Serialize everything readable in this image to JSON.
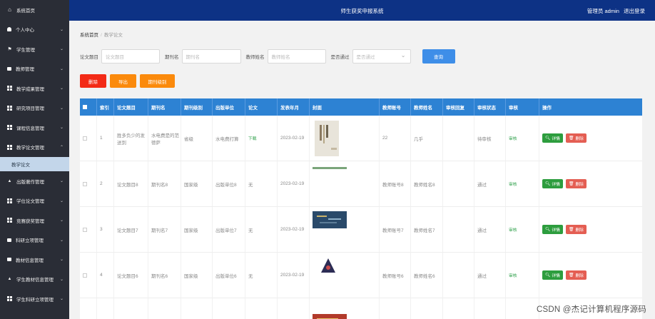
{
  "app": {
    "title": "师生获奖申报系统",
    "user_label": "管理员 admin",
    "logout": "退出登录"
  },
  "sidebar": {
    "items": [
      {
        "label": "系统首页"
      },
      {
        "label": "个人中心"
      },
      {
        "label": "学生管理"
      },
      {
        "label": "教师管理"
      },
      {
        "label": "教学成果管理"
      },
      {
        "label": "研究项目管理"
      },
      {
        "label": "课程信息管理"
      },
      {
        "label": "教学论文管理"
      },
      {
        "label": "出版著作管理"
      },
      {
        "label": "学位论文管理"
      },
      {
        "label": "竞赛获奖管理"
      },
      {
        "label": "科研立项管理"
      },
      {
        "label": "教材信息管理"
      },
      {
        "label": "学生教材信息管理"
      },
      {
        "label": "学生科研立项管理"
      }
    ],
    "active_sub": "教学论文"
  },
  "breadcrumb": {
    "home": "系统首页",
    "current": "教学论文"
  },
  "search": {
    "title_label": "论文题目",
    "title_placeholder": "论文题目",
    "journal_label": "期刊名",
    "journal_placeholder": "期刊名",
    "teacher_label": "教师姓名",
    "teacher_placeholder": "教师姓名",
    "pass_label": "是否通过",
    "pass_placeholder": "是否通过",
    "query_button": "查询"
  },
  "actions": {
    "delete": "删除",
    "export": "导出",
    "level": "期刊级别"
  },
  "table": {
    "headers": [
      "",
      "索引",
      "论文题目",
      "期刊名",
      "期刊级别",
      "出版单位",
      "论文",
      "发表年月",
      "封面",
      "教师账号",
      "教师姓名",
      "审核回复",
      "审核状态",
      "审核",
      "操作"
    ],
    "rows": [
      {
        "index": "1",
        "title": "胜多负少的发送到",
        "journal": "水电费是的范德萨",
        "level": "省级",
        "publisher": "水电费打算",
        "paper": "下载",
        "date": "2023-02-19",
        "account": "22",
        "teacher": "几乎",
        "reply": "",
        "status": "待审核",
        "audit": "审核"
      },
      {
        "index": "2",
        "title": "论文题目8",
        "journal": "期刊名8",
        "level": "国家级",
        "publisher": "出版单位8",
        "paper": "无",
        "date": "2023-02-19",
        "account": "教师账号8",
        "teacher": "教师姓名8",
        "reply": "",
        "status": "通过",
        "audit": "审核"
      },
      {
        "index": "3",
        "title": "论文题目7",
        "journal": "期刊名7",
        "level": "国家级",
        "publisher": "出版单位7",
        "paper": "无",
        "date": "2023-02-19",
        "account": "教师账号7",
        "teacher": "教师姓名7",
        "reply": "",
        "status": "通过",
        "audit": "审核"
      },
      {
        "index": "4",
        "title": "论文题目6",
        "journal": "期刊名6",
        "level": "国家级",
        "publisher": "出版单位6",
        "paper": "无",
        "date": "2023-02-19",
        "account": "教师账号6",
        "teacher": "教师姓名6",
        "reply": "",
        "status": "通过",
        "audit": "审核"
      },
      {
        "index": "",
        "title": "",
        "journal": "",
        "level": "",
        "publisher": "",
        "paper": "",
        "date": "2023-02-1",
        "account": "",
        "teacher": "",
        "reply": "",
        "status": "",
        "audit": ""
      }
    ],
    "detail_btn": "详情",
    "delete_btn": "删除"
  },
  "colors": {
    "topbar": "#0d3285",
    "sidebar": "#2a2d36",
    "header": "#2d82d3",
    "delete": "#f32a16",
    "orange": "#fb8a0c",
    "query": "#3e8ee8",
    "detail": "#2d9d3e",
    "delete_op": "#e45e53"
  },
  "watermark": "CSDN @杰记计算机程序源码"
}
